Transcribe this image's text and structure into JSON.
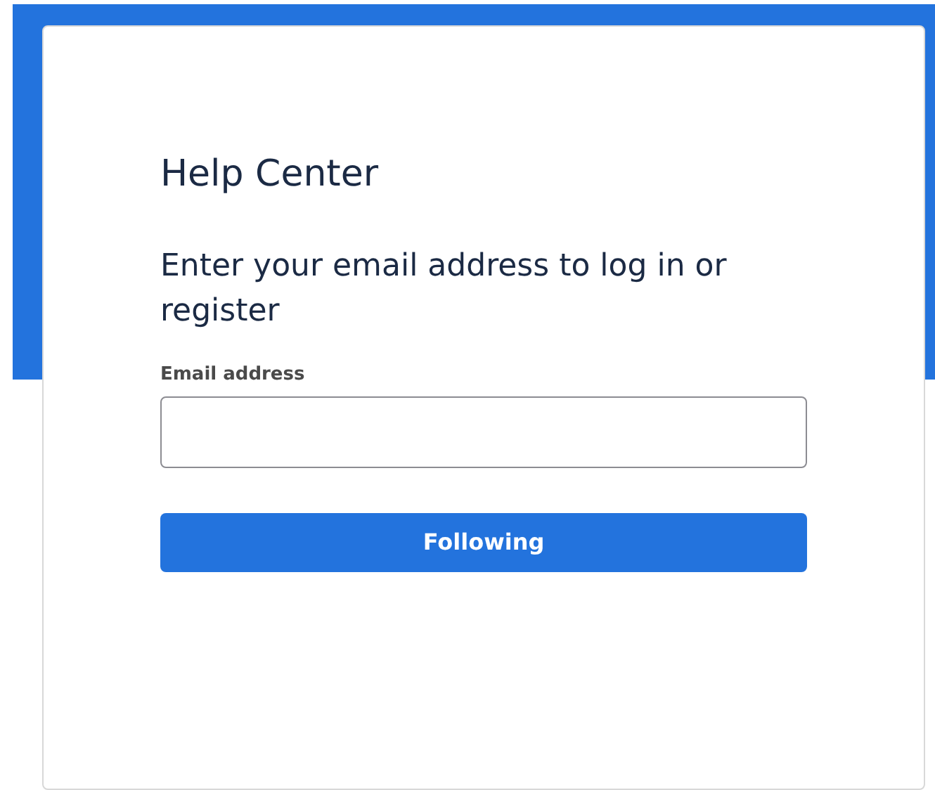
{
  "title": "Help Center",
  "subtitle": "Enter your email address to log in or register",
  "email_field": {
    "label": "Email address"
  },
  "submit_button": {
    "label": "Following"
  }
}
